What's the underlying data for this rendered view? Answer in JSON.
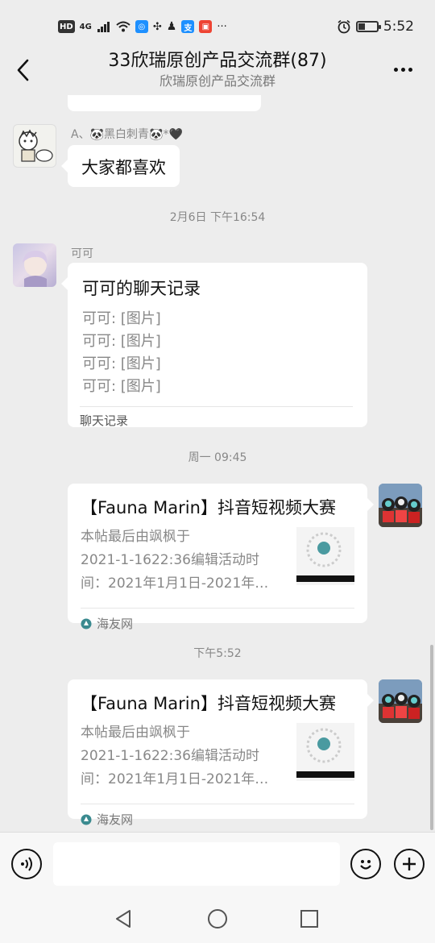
{
  "status_bar": {
    "left_icons": [
      "HD",
      "4G",
      "signal-icon",
      "wifi-icon",
      "app-icon-blue",
      "pinwheel-icon",
      "qq-penguin-icon",
      "app-icon-blue",
      "app-icon-red"
    ],
    "hd": "HD",
    "network": "4G",
    "more": "···",
    "time": "5:52",
    "battery_level": 0.35
  },
  "header": {
    "title": "33欣瑞原创产品交流群(87)",
    "subtitle": "欣瑞原创产品交流群"
  },
  "messages": {
    "msg1": {
      "sender": "A、🐼黑白刺青🐼*🖤",
      "text": "大家都喜欢"
    },
    "time1": "2月6日 下午16:54",
    "msg2": {
      "sender": "可可",
      "record_title": "可可的聊天记录",
      "lines": [
        "可可: [图片]",
        "可可: [图片]",
        "可可: [图片]",
        "可可: [图片]"
      ],
      "footer": "聊天记录"
    },
    "time2": "周一 09:45",
    "card1": {
      "title": "【Fauna Marin】抖音短视频大赛",
      "desc_lines": [
        "本帖最后由飒枫于",
        "2021-1-1622:36编辑活动时",
        "间：2021年1月1日-2021年…"
      ],
      "source": "海友网"
    },
    "time3": "下午5:52",
    "card2": {
      "title": "【Fauna Marin】抖音短视频大赛",
      "desc_lines": [
        "本帖最后由飒枫于",
        "2021-1-1622:36编辑活动时",
        "间：2021年1月1日-2021年…"
      ],
      "source": "海友网"
    }
  },
  "input": {
    "value": ""
  },
  "colors": {
    "bubble": "#ffffff",
    "background": "#ededed",
    "accent": "#1e90ff"
  }
}
